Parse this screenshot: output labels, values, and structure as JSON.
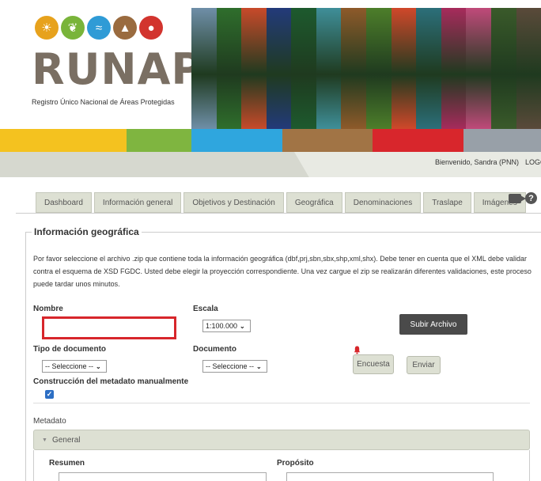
{
  "logo": {
    "word": "RUNAP",
    "subtitle": "Registro Único Nacional de Áreas Protegidas",
    "circles": [
      {
        "icon": "palm-icon",
        "color": "#e7a21d",
        "glyph": "☀"
      },
      {
        "icon": "leaf-icon",
        "color": "#79b43a",
        "glyph": "❦"
      },
      {
        "icon": "wave-icon",
        "color": "#2f9bd6",
        "glyph": "≈"
      },
      {
        "icon": "mountain-icon",
        "color": "#9a6b3f",
        "glyph": "▲"
      },
      {
        "icon": "bear-icon",
        "color": "#d2342e",
        "glyph": "●"
      }
    ]
  },
  "banner_colors": [
    "#6f8fa8",
    "#2f6e2c",
    "#c84a2a",
    "#233a7a",
    "#1d5a2e",
    "#3f8f99",
    "#8e5a2a",
    "#4d7e2a",
    "#d0482a",
    "#2c6f7a",
    "#a72b5c",
    "#c04a7a",
    "#3a5a2a",
    "#5a4a3a"
  ],
  "colorbar": [
    {
      "color": "#f4c21f",
      "width": 160
    },
    {
      "color": "#7fb540",
      "width": 82
    },
    {
      "color": "#2fa6de",
      "width": 115
    },
    {
      "color": "#a17445",
      "width": 114
    },
    {
      "color": "#d8262c",
      "width": 115
    },
    {
      "color": "#98a0a8",
      "width": 98
    }
  ],
  "user": {
    "welcome": "Bienvenido, Sandra (PNN)",
    "logout": "LOGO"
  },
  "tabs": [
    "Dashboard",
    "Información general",
    "Objetivos y Destinación",
    "Geográfica",
    "Denominaciones",
    "Traslape",
    "Imágenes"
  ],
  "tab_icons": {
    "video": "video-icon",
    "help": "help-icon"
  },
  "section": {
    "title": "Información geográfica",
    "intro": "Por favor seleccione el archivo .zip que contiene toda la información geográfica (dbf,prj,sbn,sbx,shp,xml,shx). Debe tener en cuenta que el XML debe validar contra el esquema de XSD FGDC. Usted debe elegir la proyección correspondiente. Una vez cargue el zip se realizarán diferentes validaciones, este proceso puede tardar unos minutos."
  },
  "form": {
    "nombre_label": "Nombre",
    "nombre_value": "",
    "escala_label": "Escala",
    "escala_value": "1:100.000",
    "tipo_label": "Tipo de documento",
    "tipo_value": "-- Seleccione --",
    "documento_label": "Documento",
    "documento_value": "-- Seleccione --",
    "construccion_label": "Construcción del metadato manualmente",
    "construccion_checked": true
  },
  "buttons": {
    "upload": "Subir Archivo",
    "encuesta": "Encuesta",
    "enviar": "Enviar"
  },
  "metadata": {
    "label": "Metadato",
    "accordion_title": "General",
    "resumen_label": "Resumen",
    "proposito_label": "Propósito"
  }
}
